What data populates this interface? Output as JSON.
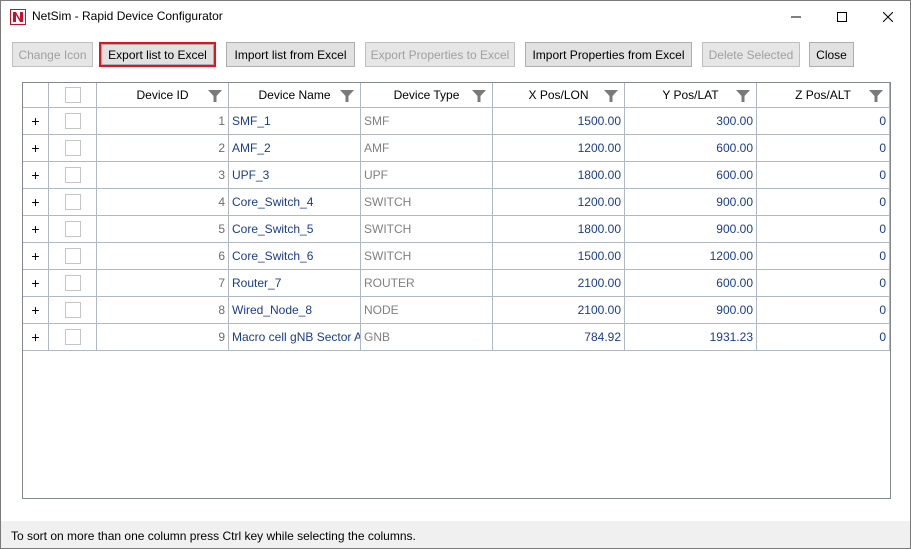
{
  "window": {
    "title": "NetSim - Rapid Device Configurator",
    "app_icon": "netsim-logo-icon",
    "controls": [
      "minimize-icon",
      "maximize-icon",
      "close-icon"
    ]
  },
  "toolbar": {
    "change_icon": "Change Icon",
    "export_list": "Export list to Excel",
    "import_list": "Import list from Excel",
    "export_props": "Export Properties to Excel",
    "import_props": "Import Properties from Excel",
    "delete_selected": "Delete Selected",
    "close": "Close"
  },
  "grid": {
    "columns": [
      "Device ID",
      "Device Name",
      "Device Type",
      "X Pos/LON",
      "Y Pos/LAT",
      "Z Pos/ALT"
    ],
    "rows": [
      {
        "expand": "+",
        "id": "1",
        "name": "SMF_1",
        "type": "SMF",
        "x": "1500.00",
        "y": "300.00",
        "z": "0"
      },
      {
        "expand": "+",
        "id": "2",
        "name": "AMF_2",
        "type": "AMF",
        "x": "1200.00",
        "y": "600.00",
        "z": "0"
      },
      {
        "expand": "+",
        "id": "3",
        "name": "UPF_3",
        "type": "UPF",
        "x": "1800.00",
        "y": "600.00",
        "z": "0"
      },
      {
        "expand": "+",
        "id": "4",
        "name": "Core_Switch_4",
        "type": "SWITCH",
        "x": "1200.00",
        "y": "900.00",
        "z": "0"
      },
      {
        "expand": "+",
        "id": "5",
        "name": "Core_Switch_5",
        "type": "SWITCH",
        "x": "1800.00",
        "y": "900.00",
        "z": "0"
      },
      {
        "expand": "+",
        "id": "6",
        "name": "Core_Switch_6",
        "type": "SWITCH",
        "x": "1500.00",
        "y": "1200.00",
        "z": "0"
      },
      {
        "expand": "+",
        "id": "7",
        "name": "Router_7",
        "type": "ROUTER",
        "x": "2100.00",
        "y": "600.00",
        "z": "0"
      },
      {
        "expand": "+",
        "id": "8",
        "name": "Wired_Node_8",
        "type": "NODE",
        "x": "2100.00",
        "y": "900.00",
        "z": "0"
      },
      {
        "expand": "+",
        "id": "9",
        "name": "Macro cell gNB Sector A",
        "type": "GNB",
        "x": "784.92",
        "y": "1931.23",
        "z": "0"
      }
    ]
  },
  "status": {
    "text": "To sort on more than one column press Ctrl key while selecting the columns."
  },
  "colors": {
    "highlight_border": "#e0141e",
    "link_text": "#1a3c8f",
    "muted_text": "#808080"
  }
}
